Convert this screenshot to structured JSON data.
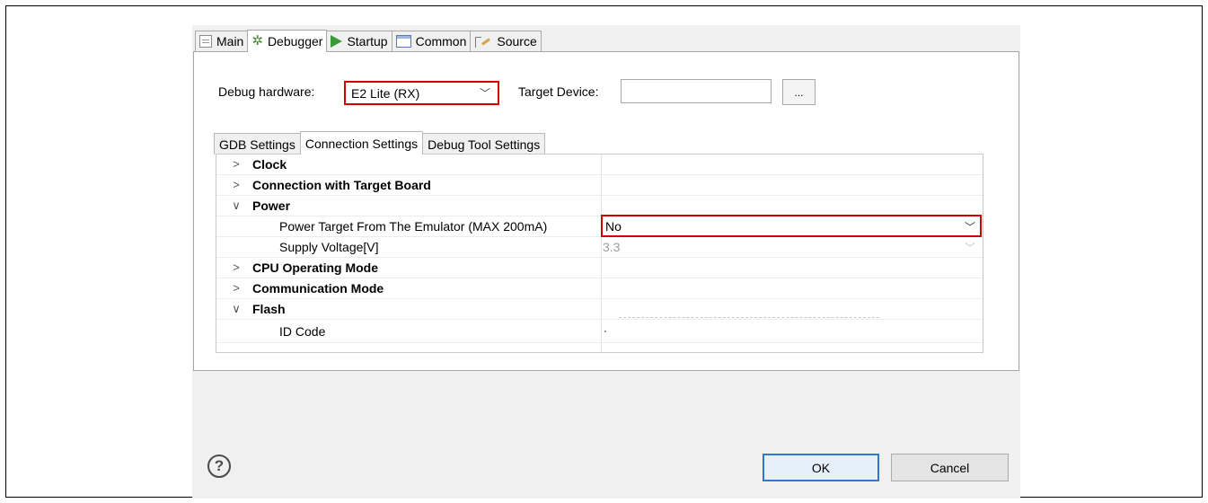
{
  "tabs": [
    {
      "label": "Main",
      "icon": "file-icon"
    },
    {
      "label": "Debugger",
      "icon": "bug-icon"
    },
    {
      "label": "Startup",
      "icon": "play-icon"
    },
    {
      "label": "Common",
      "icon": "common-icon"
    },
    {
      "label": "Source",
      "icon": "source-icon"
    }
  ],
  "active_tab": "Debugger",
  "debug_hardware": {
    "label": "Debug hardware:",
    "value": "E2 Lite (RX)"
  },
  "target_device": {
    "label": "Target Device:",
    "value": "",
    "browse_label": "..."
  },
  "sub_tabs": [
    {
      "label": "GDB Settings"
    },
    {
      "label": "Connection Settings"
    },
    {
      "label": "Debug Tool Settings"
    }
  ],
  "active_sub_tab": "Connection Settings",
  "tree": {
    "clock": "Clock",
    "connection": "Connection with Target Board",
    "power": "Power",
    "power_target_label": "Power Target From The Emulator (MAX 200mA)",
    "power_target_value": "No",
    "supply_voltage_label": "Supply Voltage[V]",
    "supply_voltage_value": "3.3",
    "cpu_mode": "CPU Operating Mode",
    "comm_mode": "Communication Mode",
    "flash": "Flash",
    "id_code": "ID Code"
  },
  "buttons": {
    "ok": "OK",
    "cancel": "Cancel",
    "help": "?"
  },
  "colors": {
    "highlight": "#d40000",
    "default_button": "#2a7ad5"
  }
}
